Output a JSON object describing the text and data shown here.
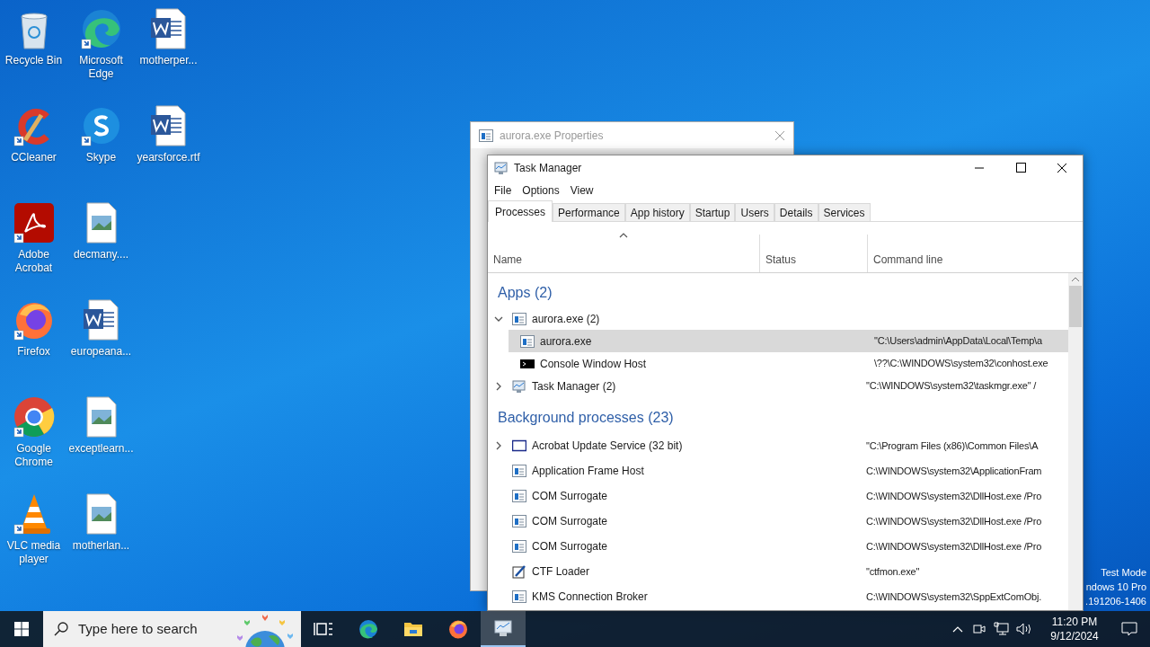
{
  "desktop_icons": [
    {
      "label": "Recycle Bin",
      "kind": "recycle",
      "shortcut": false
    },
    {
      "label": "CCleaner",
      "kind": "ccleaner",
      "shortcut": true
    },
    {
      "label": "Adobe Acrobat",
      "kind": "acrobat",
      "shortcut": true
    },
    {
      "label": "Firefox",
      "kind": "firefox",
      "shortcut": true
    },
    {
      "label": "Google Chrome",
      "kind": "chrome",
      "shortcut": true
    },
    {
      "label": "VLC media player",
      "kind": "vlc",
      "shortcut": true
    },
    {
      "label": "Microsoft Edge",
      "kind": "edge",
      "shortcut": true
    },
    {
      "label": "Skype",
      "kind": "skype",
      "shortcut": true
    },
    {
      "label": "decmany....",
      "kind": "image",
      "shortcut": false
    },
    {
      "label": "europeana...",
      "kind": "word",
      "shortcut": false
    },
    {
      "label": "exceptlearn...",
      "kind": "image",
      "shortcut": false
    },
    {
      "label": "motherlan...",
      "kind": "image",
      "shortcut": false
    },
    {
      "label": "motherper...",
      "kind": "word",
      "shortcut": false
    },
    {
      "label": "yearsforce.rtf",
      "kind": "word",
      "shortcut": false
    }
  ],
  "properties_window": {
    "title": "aurora.exe Properties"
  },
  "task_manager": {
    "title": "Task Manager",
    "menu": [
      "File",
      "Options",
      "View"
    ],
    "tabs": [
      {
        "label": "Processes",
        "selected": true
      },
      {
        "label": "Performance",
        "selected": false
      },
      {
        "label": "App history",
        "selected": false
      },
      {
        "label": "Startup",
        "selected": false
      },
      {
        "label": "Users",
        "selected": false
      },
      {
        "label": "Details",
        "selected": false
      },
      {
        "label": "Services",
        "selected": false
      }
    ],
    "columns": [
      {
        "label": "Name",
        "sorted": true
      },
      {
        "label": "Status",
        "sorted": false
      },
      {
        "label": "Command line",
        "sorted": false
      }
    ],
    "groups": [
      {
        "title": "Apps (2)",
        "rows": [
          {
            "name": "aurora.exe (2)",
            "kind": "window",
            "expanded": true,
            "selected": false,
            "children": [
              {
                "name": "aurora.exe",
                "kind": "window",
                "selected": true,
                "command": "\"C:\\Users\\admin\\AppData\\Local\\Temp\\a"
              },
              {
                "name": "Console Window Host",
                "kind": "console",
                "selected": false,
                "command": "\\??\\C:\\WINDOWS\\system32\\conhost.exe"
              }
            ]
          },
          {
            "name": "Task Manager (2)",
            "kind": "taskmgr",
            "expanded": false,
            "selected": false,
            "command": "\"C:\\WINDOWS\\system32\\taskmgr.exe\" /"
          }
        ]
      },
      {
        "title": "Background processes (23)",
        "rows": [
          {
            "name": "Acrobat Update Service (32 bit)",
            "kind": "frame",
            "expanded": false,
            "selected": false,
            "command": "\"C:\\Program Files (x86)\\Common Files\\A"
          },
          {
            "name": "Application Frame Host",
            "kind": "window",
            "selected": false,
            "command": "C:\\WINDOWS\\system32\\ApplicationFram"
          },
          {
            "name": "COM Surrogate",
            "kind": "window",
            "selected": false,
            "command": "C:\\WINDOWS\\system32\\DllHost.exe /Pro"
          },
          {
            "name": "COM Surrogate",
            "kind": "window",
            "selected": false,
            "command": "C:\\WINDOWS\\system32\\DllHost.exe /Pro"
          },
          {
            "name": "COM Surrogate",
            "kind": "window",
            "selected": false,
            "command": "C:\\WINDOWS\\system32\\DllHost.exe /Pro"
          },
          {
            "name": "CTF Loader",
            "kind": "pen",
            "selected": false,
            "command": "\"ctfmon.exe\""
          },
          {
            "name": "KMS Connection Broker",
            "kind": "window",
            "selected": false,
            "command": "C:\\WINDOWS\\system32\\SppExtComObj."
          }
        ]
      }
    ]
  },
  "system_info_lines": [
    "Test Mode",
    "ndows 10 Pro",
    ".191206-1406"
  ],
  "taskbar": {
    "search": {
      "placeholder": "Type here to search"
    },
    "apps": [
      {
        "kind": "taskview",
        "active": false
      },
      {
        "kind": "edge",
        "active": false
      },
      {
        "kind": "explorer",
        "active": false
      },
      {
        "kind": "firefox",
        "active": false
      },
      {
        "kind": "taskmgr",
        "active": true
      }
    ],
    "clock": {
      "time": "11:20 PM",
      "date": "9/12/2024"
    }
  }
}
